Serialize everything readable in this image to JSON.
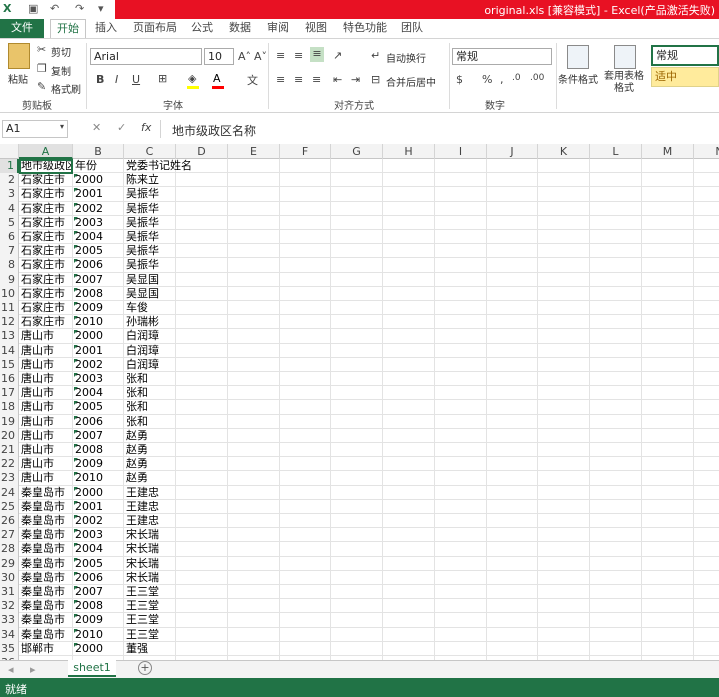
{
  "window": {
    "title": "original.xls  [兼容模式]  -  Excel(产品激活失败)"
  },
  "tabs": [
    "文件",
    "开始",
    "插入",
    "页面布局",
    "公式",
    "数据",
    "审阅",
    "视图",
    "特色功能",
    "团队"
  ],
  "active_tab": "开始",
  "ribbon": {
    "clipboard": {
      "paste": "粘贴",
      "cut": "剪切",
      "copy": "复制",
      "format_painter": "格式刷",
      "group": "剪贴板"
    },
    "font": {
      "name": "Arial",
      "size": "10",
      "bold": "B",
      "italic": "I",
      "underline": "U",
      "group": "字体"
    },
    "alignment": {
      "wrap": "自动换行",
      "merge": "合并后居中",
      "group": "对齐方式"
    },
    "number": {
      "format": "常规",
      "group": "数字"
    },
    "styles": {
      "conditional": "条件格式",
      "table": "套用表格格式",
      "style_normal": "常规",
      "style_neutral": "适中"
    }
  },
  "formula_bar": {
    "name_box": "A1",
    "content": "地市级政区名称"
  },
  "columns": [
    "A",
    "B",
    "C",
    "D",
    "E",
    "F",
    "G",
    "H",
    "I",
    "J",
    "K",
    "L",
    "M",
    "N"
  ],
  "rows": [
    [
      "地市级政区名称",
      "年份",
      "党委书记姓名"
    ],
    [
      "石家庄市",
      "2000",
      "陈来立"
    ],
    [
      "石家庄市",
      "2001",
      "吴振华"
    ],
    [
      "石家庄市",
      "2002",
      "吴振华"
    ],
    [
      "石家庄市",
      "2003",
      "吴振华"
    ],
    [
      "石家庄市",
      "2004",
      "吴振华"
    ],
    [
      "石家庄市",
      "2005",
      "吴振华"
    ],
    [
      "石家庄市",
      "2006",
      "吴振华"
    ],
    [
      "石家庄市",
      "2007",
      "吴显国"
    ],
    [
      "石家庄市",
      "2008",
      "吴显国"
    ],
    [
      "石家庄市",
      "2009",
      "车俊"
    ],
    [
      "石家庄市",
      "2010",
      "孙瑞彬"
    ],
    [
      "唐山市",
      "2000",
      "白润璋"
    ],
    [
      "唐山市",
      "2001",
      "白润璋"
    ],
    [
      "唐山市",
      "2002",
      "白润璋"
    ],
    [
      "唐山市",
      "2003",
      "张和"
    ],
    [
      "唐山市",
      "2004",
      "张和"
    ],
    [
      "唐山市",
      "2005",
      "张和"
    ],
    [
      "唐山市",
      "2006",
      "张和"
    ],
    [
      "唐山市",
      "2007",
      "赵勇"
    ],
    [
      "唐山市",
      "2008",
      "赵勇"
    ],
    [
      "唐山市",
      "2009",
      "赵勇"
    ],
    [
      "唐山市",
      "2010",
      "赵勇"
    ],
    [
      "秦皇岛市",
      "2000",
      "王建忠"
    ],
    [
      "秦皇岛市",
      "2001",
      "王建忠"
    ],
    [
      "秦皇岛市",
      "2002",
      "王建忠"
    ],
    [
      "秦皇岛市",
      "2003",
      "宋长瑞"
    ],
    [
      "秦皇岛市",
      "2004",
      "宋长瑞"
    ],
    [
      "秦皇岛市",
      "2005",
      "宋长瑞"
    ],
    [
      "秦皇岛市",
      "2006",
      "宋长瑞"
    ],
    [
      "秦皇岛市",
      "2007",
      "王三堂"
    ],
    [
      "秦皇岛市",
      "2008",
      "王三堂"
    ],
    [
      "秦皇岛市",
      "2009",
      "王三堂"
    ],
    [
      "秦皇岛市",
      "2010",
      "王三堂"
    ],
    [
      "邯郸市",
      "2000",
      "董强"
    ]
  ],
  "sheet_tab": "sheet1",
  "status": "就绪",
  "colors": {
    "excel_green": "#217346",
    "title_red": "#e81123"
  }
}
